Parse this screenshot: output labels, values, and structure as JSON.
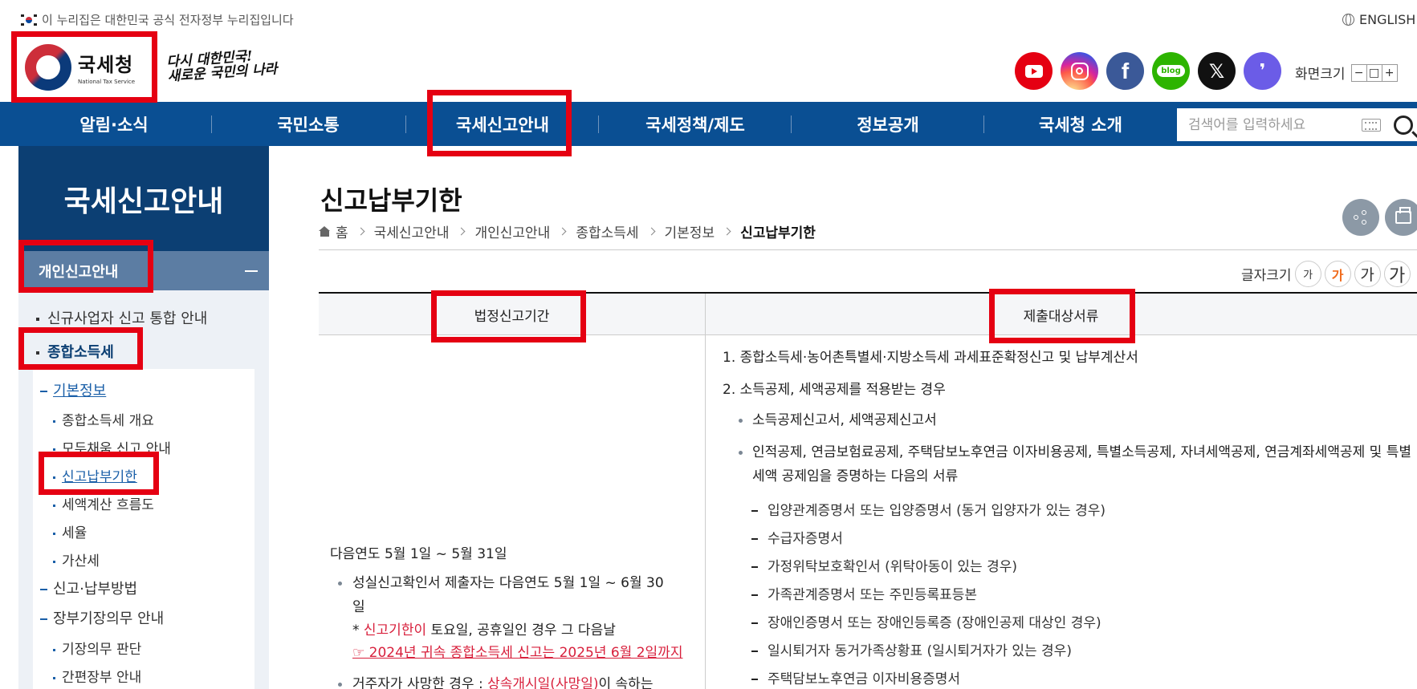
{
  "gov_banner": "이 누리집은 대한민국 공식 전자정부 누리집입니다",
  "lang_link": "ENGLISH",
  "logo": {
    "kor": "국세청",
    "eng": "National Tax Service"
  },
  "slogan": {
    "line1": "다시 대한민국!",
    "line2": "새로운 국민의 나라"
  },
  "social": [
    {
      "name": "youtube",
      "color": "#e50012"
    },
    {
      "name": "instagram",
      "color": "#d6249f"
    },
    {
      "name": "facebook",
      "color": "#3b5998",
      "glyph": "f"
    },
    {
      "name": "blog",
      "color": "#2db400",
      "glyph": "blog"
    },
    {
      "name": "x",
      "color": "#111111",
      "glyph": "𝕏"
    },
    {
      "name": "kakao-story",
      "color": "#6b5ce7",
      "glyph": "❜"
    }
  ],
  "screen_size": {
    "label": "화면크기",
    "minus": "−",
    "reset": "□",
    "plus": "+"
  },
  "gnb": {
    "items": [
      "알림·소식",
      "국민소통",
      "국세신고안내",
      "국세정책/제도",
      "정보공개",
      "국세청 소개"
    ],
    "search_placeholder": "검색어를 입력하세요"
  },
  "sidebar": {
    "title": "국세신고안내",
    "section": "개인신고안내",
    "level1": [
      "신규사업자 신고 통합 안내",
      "종합소득세"
    ],
    "level2": [
      "기본정보",
      "신고·납부방법",
      "장부기장의무 안내"
    ],
    "level3_basic": [
      "종합소득세 개요",
      "모두채움 신고 안내",
      "신고납부기한",
      "세액계산 흐름도",
      "세율",
      "가산세"
    ],
    "level3_ledger": [
      "기장의무 판단",
      "간편장부 안내"
    ]
  },
  "content": {
    "title": "신고납부기한",
    "breadcrumb": [
      "홈",
      "국세신고안내",
      "개인신고안내",
      "종합소득세",
      "기본정보",
      "신고납부기한"
    ],
    "font_size_label": "글자크기",
    "font_sizes": [
      "가",
      "가",
      "가",
      "가"
    ],
    "table": {
      "headers": [
        "법정신고기간",
        "제출대상서류"
      ],
      "col1": {
        "period": "다음연도 5월 1일 ~ 5월 31일",
        "bullet1_a": "성실신고확인서 제출자는 다음연도 5월 1일 ~ 6월 30",
        "bullet1_b": "일",
        "note_prefix": "* ",
        "note_red": "신고기한이",
        "note_rest": " 토요일, 공휴일인 경우 그 다음날",
        "link": "☞ 2024년 귀속 종합소득세 신고는 2025년 6월 2일까지",
        "bullet2_a": "거주자가 사망한 경우 : ",
        "bullet2_red": "상속개시일(사망일)",
        "bullet2_b": "이 속하는"
      },
      "col2": {
        "n1": "1. 종합소득세·농어촌특별세·지방소득세 과세표준확정신고 및 납부계산서",
        "n2": "2. 소득공제, 세액공제를 적용받는 경우",
        "b1": "소득공제신고서, 세액공제신고서",
        "b2": "인적공제, 연금보험료공제, 주택담보노후연금 이자비용공제, 특별소득공제, 자녀세액공제, 연금계좌세액공제 및 특별세액 공제임을 증명하는 다음의 서류",
        "docs": [
          "입양관계증명서 또는 입양증명서 (동거 입양자가 있는 경우)",
          "수급자증명서",
          "가정위탁보호확인서 (위탁아동이 있는 경우)",
          "가족관계증명서 또는 주민등록표등본",
          "장애인증명서 또는 장애인등록증 (장애인공제 대상인 경우)",
          "일시퇴거자 동거가족상황표 (일시퇴거자가 있는 경우)",
          "주택담보노후연금 이자비용증명서"
        ]
      }
    }
  }
}
